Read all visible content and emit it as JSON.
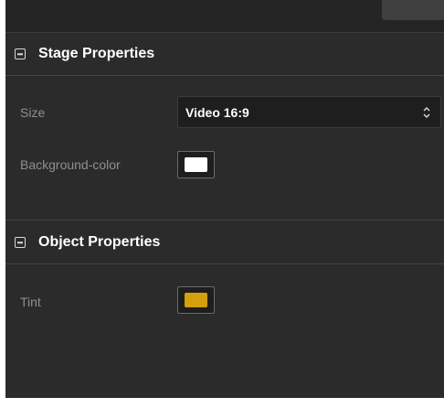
{
  "stage": {
    "title": "Stage Properties",
    "size_label": "Size",
    "size_value": "Video 16:9",
    "bg_label": "Background-color",
    "bg_color": "#ffffff"
  },
  "object": {
    "title": "Object Properties",
    "tint_label": "Tint",
    "tint_color": "#d4a00c"
  },
  "icons": {
    "collapse": "minus-square-icon",
    "select_arrows": "chevron-up-down-icon"
  }
}
